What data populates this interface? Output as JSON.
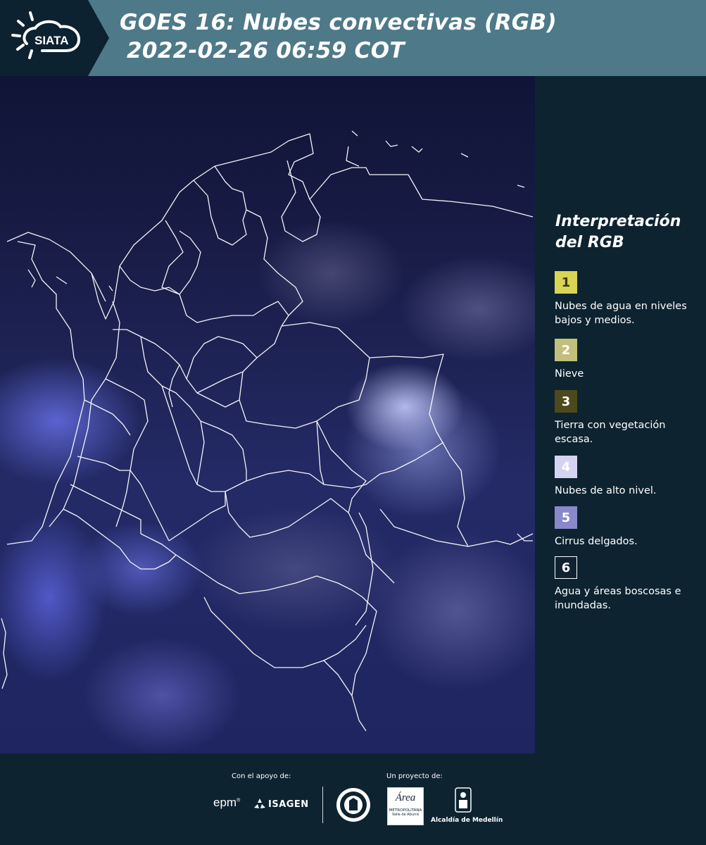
{
  "header": {
    "logo_text": "SIATA",
    "title_line1": "GOES 16: Nubes convectivas (RGB)",
    "title_line2": "2022-02-26 06:59 COT"
  },
  "legend": {
    "title_line1": "Interpretación",
    "title_line2": "del RGB",
    "items": [
      {
        "number": "1",
        "color": "#d8d454",
        "text_color": "#3a3a10",
        "label": "Nubes de agua en niveles bajos y medios."
      },
      {
        "number": "2",
        "color": "#c2bf7c",
        "text_color": "#ffffff",
        "label": "Nieve"
      },
      {
        "number": "3",
        "color": "#4c4a1c",
        "text_color": "#ffffff",
        "label": "Tierra con vegetación escasa."
      },
      {
        "number": "4",
        "color": "#d4d4f2",
        "text_color": "#ffffff",
        "label": "Nubes de alto nivel."
      },
      {
        "number": "5",
        "color": "#8a88cc",
        "text_color": "#ffffff",
        "label": "Cirrus delgados."
      },
      {
        "number": "6",
        "color": "#0f2230",
        "text_color": "#ffffff",
        "label": "Agua y áreas boscosas e inundadas."
      }
    ]
  },
  "footer": {
    "support_label": "Con el apoyo de:",
    "project_label": "Un proyecto de:",
    "epm": "epm",
    "isagen": "ISAGEN",
    "area_line1": "Área",
    "area_line2": "METROPOLITANA",
    "area_line3": "Valle de Aburrá",
    "alcaldia": "Alcaldía de Medellín"
  }
}
